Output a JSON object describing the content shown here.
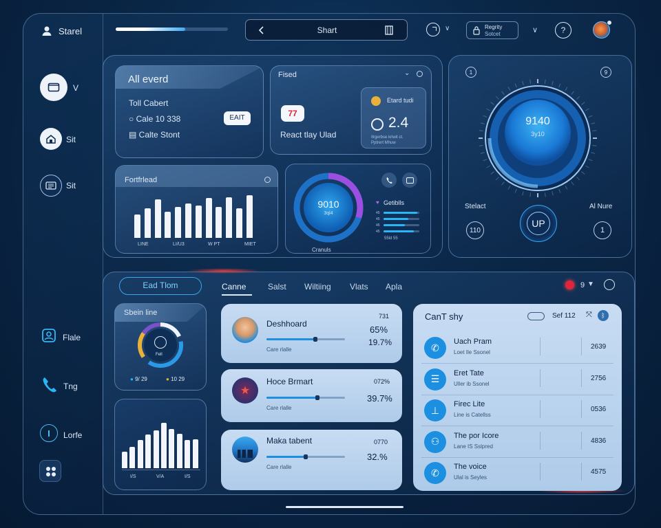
{
  "sidebar": {
    "user_name": "Starel",
    "items": [
      {
        "label": "V"
      },
      {
        "label": "Sit"
      },
      {
        "label": "Sit"
      },
      {
        "label": "Flale"
      },
      {
        "label": "Tng"
      },
      {
        "label": "Lorfe"
      }
    ]
  },
  "topbar": {
    "progress": 0.62,
    "search_title": "Shart",
    "account_line1": "Regrity",
    "account_line2": "Sotcet"
  },
  "overview": {
    "card_title": "All everd",
    "line1": "Toll Cabert",
    "line2": "Cale 10 338",
    "line3": "Calte Stont",
    "edit_label": "EAIT"
  },
  "feed": {
    "title": "Fised",
    "badge": "77",
    "caption": "React tlay Ulad",
    "stat_label": "Etard tudi",
    "stat_value": "2.4",
    "stat_sub1": "Ilrgerbse kriwit ct.",
    "stat_sub2": "Pptrert Mhuw"
  },
  "chart_panel": {
    "title": "Fortfrlead",
    "tick_labels": [
      "LINE",
      "LI/U3",
      "W PT",
      "MIET"
    ]
  },
  "chart_data": [
    {
      "type": "bar",
      "values": [
        38,
        48,
        62,
        42,
        50,
        56,
        52,
        64,
        50,
        66,
        48,
        69
      ],
      "title": "Fortfrlead"
    },
    {
      "type": "bar",
      "values": [
        35,
        45,
        58,
        70,
        78,
        95,
        82,
        72,
        58,
        60
      ],
      "tick_labels": [
        "I/S",
        "V/A",
        "I/S"
      ]
    }
  ],
  "ring": {
    "value": "9010",
    "sub": "3ql4",
    "caption": "Cranuls",
    "fraction": 0.3
  },
  "details": {
    "title": "Getiblls",
    "rows": [
      {
        "label": "45",
        "fill": 0.95
      },
      {
        "label": "45",
        "fill": 0.7
      },
      {
        "label": "45",
        "fill": 0.6
      },
      {
        "label": "45",
        "fill": 0.85
      }
    ],
    "footer": "55ld 55"
  },
  "dial": {
    "value": "9140",
    "sub": "3y10",
    "left_label": "Stelact",
    "left_value": "110",
    "right_label": "Al Nure",
    "right_value": "1",
    "center_label": "UP",
    "top_left_num": "1",
    "top_right_num": "9"
  },
  "bottom": {
    "primary_button": "Ead Tlom",
    "tabs": [
      "Canne",
      "Salst",
      "Wiltiing",
      "Vlats",
      "Apla"
    ],
    "status_num": "9"
  },
  "speed_card": {
    "title": "Sbein line",
    "center": "Fell",
    "legend1": "9/ 29",
    "legend2": "10 29"
  },
  "media_cards": [
    {
      "title": "Deshhoard",
      "meta1": "731",
      "meta2": "65%",
      "meta3": "19.7%",
      "sub": "Care rlalle",
      "progress": 0.62
    },
    {
      "title": "Hoce Brmart",
      "meta1": "072%",
      "meta2": "39.7%",
      "sub": "Care rlalle",
      "progress": 0.65
    },
    {
      "title": "Maka tabent",
      "meta1": "0770",
      "meta2": "32.%",
      "sub": "Care rlalle",
      "progress": 0.5
    }
  ],
  "contacts": {
    "title": "CanT shy",
    "badge": "Sef 112",
    "rows": [
      {
        "name": "Uach Pram",
        "sub": "Loet Ile Ssonel",
        "value": "2639"
      },
      {
        "name": "Eret Tate",
        "sub": "Uller ib Ssonel",
        "value": "2756"
      },
      {
        "name": "Firec Lite",
        "sub": "Line is Catellss",
        "value": "0536"
      },
      {
        "name": "The por Icore",
        "sub": "Lane IS Sslpred",
        "value": "4836"
      },
      {
        "name": "The voice",
        "sub": "Ulal is Seyles",
        "value": "4575"
      }
    ]
  },
  "colors": {
    "accent": "#1c8fe0",
    "purple": "#9b4fe0",
    "alert": "#e0243a",
    "gold": "#e8b23a"
  }
}
